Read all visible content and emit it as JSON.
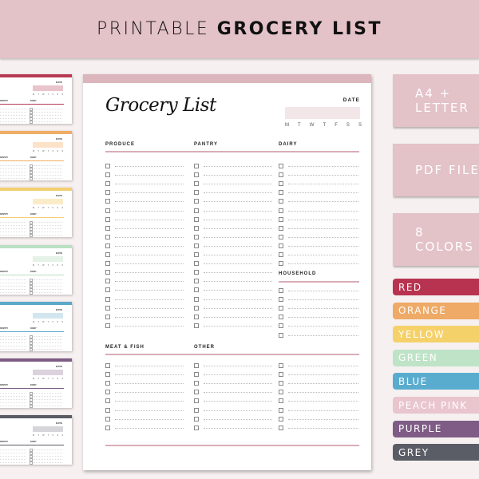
{
  "banner": {
    "title_light": "PRINTABLE ",
    "title_bold": "GROCERY LIST"
  },
  "thumbnails": [
    {
      "name": "red",
      "accent": "#b83a52",
      "box": "#e8c4cb"
    },
    {
      "name": "orange",
      "accent": "#f0ad63",
      "box": "#fbe2c8"
    },
    {
      "name": "yellow",
      "accent": "#f4cf72",
      "box": "#faecc9"
    },
    {
      "name": "green",
      "accent": "#b9e0c1",
      "box": "#e4f2e7"
    },
    {
      "name": "blue",
      "accent": "#5aa8c8",
      "box": "#d3e6ef"
    },
    {
      "name": "purple",
      "accent": "#7c5c84",
      "box": "#dcd2de"
    },
    {
      "name": "grey",
      "accent": "#595b64",
      "box": "#d6d6da"
    }
  ],
  "thumb_text": {
    "date": "DATE",
    "col1": "PANTRY",
    "col2": "DAIRY",
    "days": [
      "M",
      "T",
      "W",
      "T",
      "F",
      "S",
      "S"
    ]
  },
  "page": {
    "heading": "Grocery List",
    "date_label": "DATE",
    "days": [
      "M",
      "T",
      "W",
      "T",
      "F",
      "S",
      "S"
    ],
    "accent": "#dbb6bd",
    "sections": {
      "produce": {
        "label": "PRODUCE",
        "rows": 19
      },
      "pantry": {
        "label": "PANTRY",
        "rows": 19
      },
      "dairy": {
        "label": "DAIRY",
        "rows": 12
      },
      "household": {
        "label": "HOUSEHOLD",
        "rows": 6
      },
      "meat_fish": {
        "label": "MEAT & FISH",
        "rows": 8
      },
      "other": {
        "label": "OTHER",
        "rows": 8
      },
      "other2": {
        "label": "",
        "rows": 8
      }
    }
  },
  "badges": [
    {
      "label": "A4 + LETTER"
    },
    {
      "label": "PDF FILE"
    },
    {
      "label": "8 COLORS"
    }
  ],
  "colors": [
    {
      "label": "RED",
      "hex": "#b8334f"
    },
    {
      "label": "ORANGE",
      "hex": "#eeaa66"
    },
    {
      "label": "YELLOW",
      "hex": "#f5d16a"
    },
    {
      "label": "GREEN",
      "hex": "#bfe3c7"
    },
    {
      "label": "BLUE",
      "hex": "#5aaccf"
    },
    {
      "label": "PEACH PINK",
      "hex": "#e9c5cd"
    },
    {
      "label": "PURPLE",
      "hex": "#7f5c86"
    },
    {
      "label": "GREY",
      "hex": "#5a5c66"
    }
  ]
}
